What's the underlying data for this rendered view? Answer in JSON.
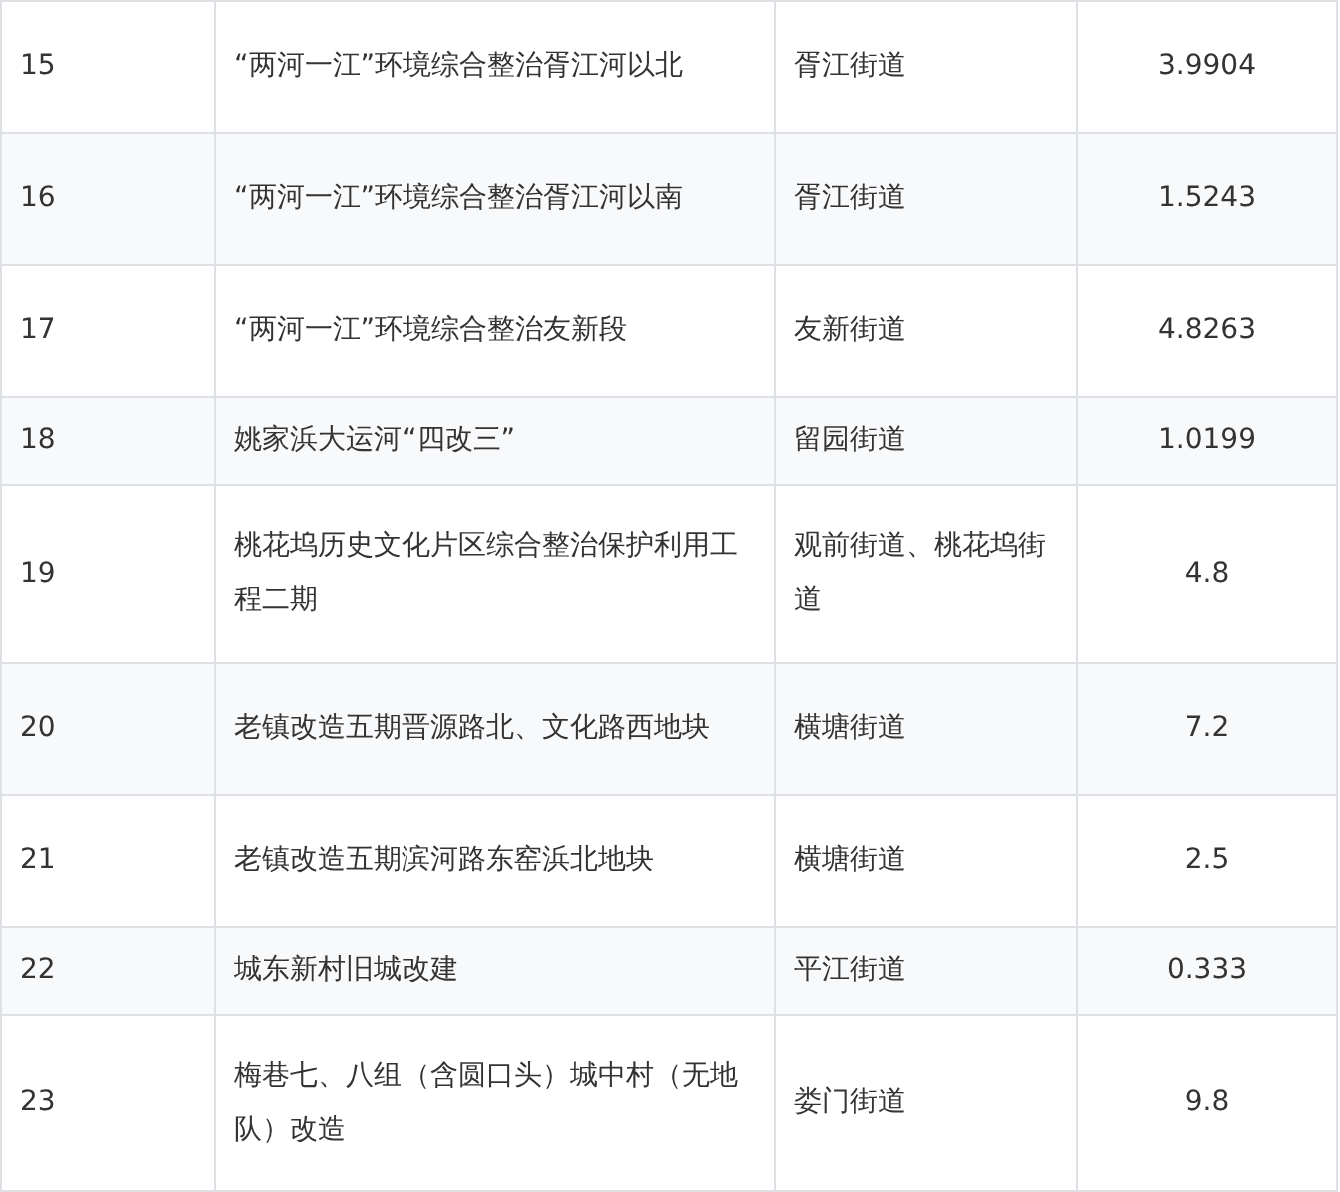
{
  "table": {
    "rows": [
      {
        "no": "15",
        "project": "“两河一江”环境综合整治胥江河以北",
        "street": "胥江街道",
        "value": "3.9904"
      },
      {
        "no": "16",
        "project": "“两河一江”环境综合整治胥江河以南",
        "street": "胥江街道",
        "value": "1.5243"
      },
      {
        "no": "17",
        "project": "“两河一江”环境综合整治友新段",
        "street": "友新街道",
        "value": "4.8263"
      },
      {
        "no": "18",
        "project": "姚家浜大运河“四改三”",
        "street": "留园街道",
        "value": "1.0199"
      },
      {
        "no": "19",
        "project": "桃花坞历史文化片区综合整治保护利用工程二期",
        "street": "观前街道、桃花坞街道",
        "value": "4.8"
      },
      {
        "no": "20",
        "project": "老镇改造五期晋源路北、文化路西地块",
        "street": "横塘街道",
        "value": "7.2"
      },
      {
        "no": "21",
        "project": "老镇改造五期滨河路东窑浜北地块",
        "street": "横塘街道",
        "value": "2.5"
      },
      {
        "no": "22",
        "project": "城东新村旧城改建",
        "street": "平江街道",
        "value": "0.333"
      },
      {
        "no": "23",
        "project": "梅巷七、八组（含圆口头）城中村（无地队）改造",
        "street": "娄门街道",
        "value": "9.8"
      }
    ]
  }
}
